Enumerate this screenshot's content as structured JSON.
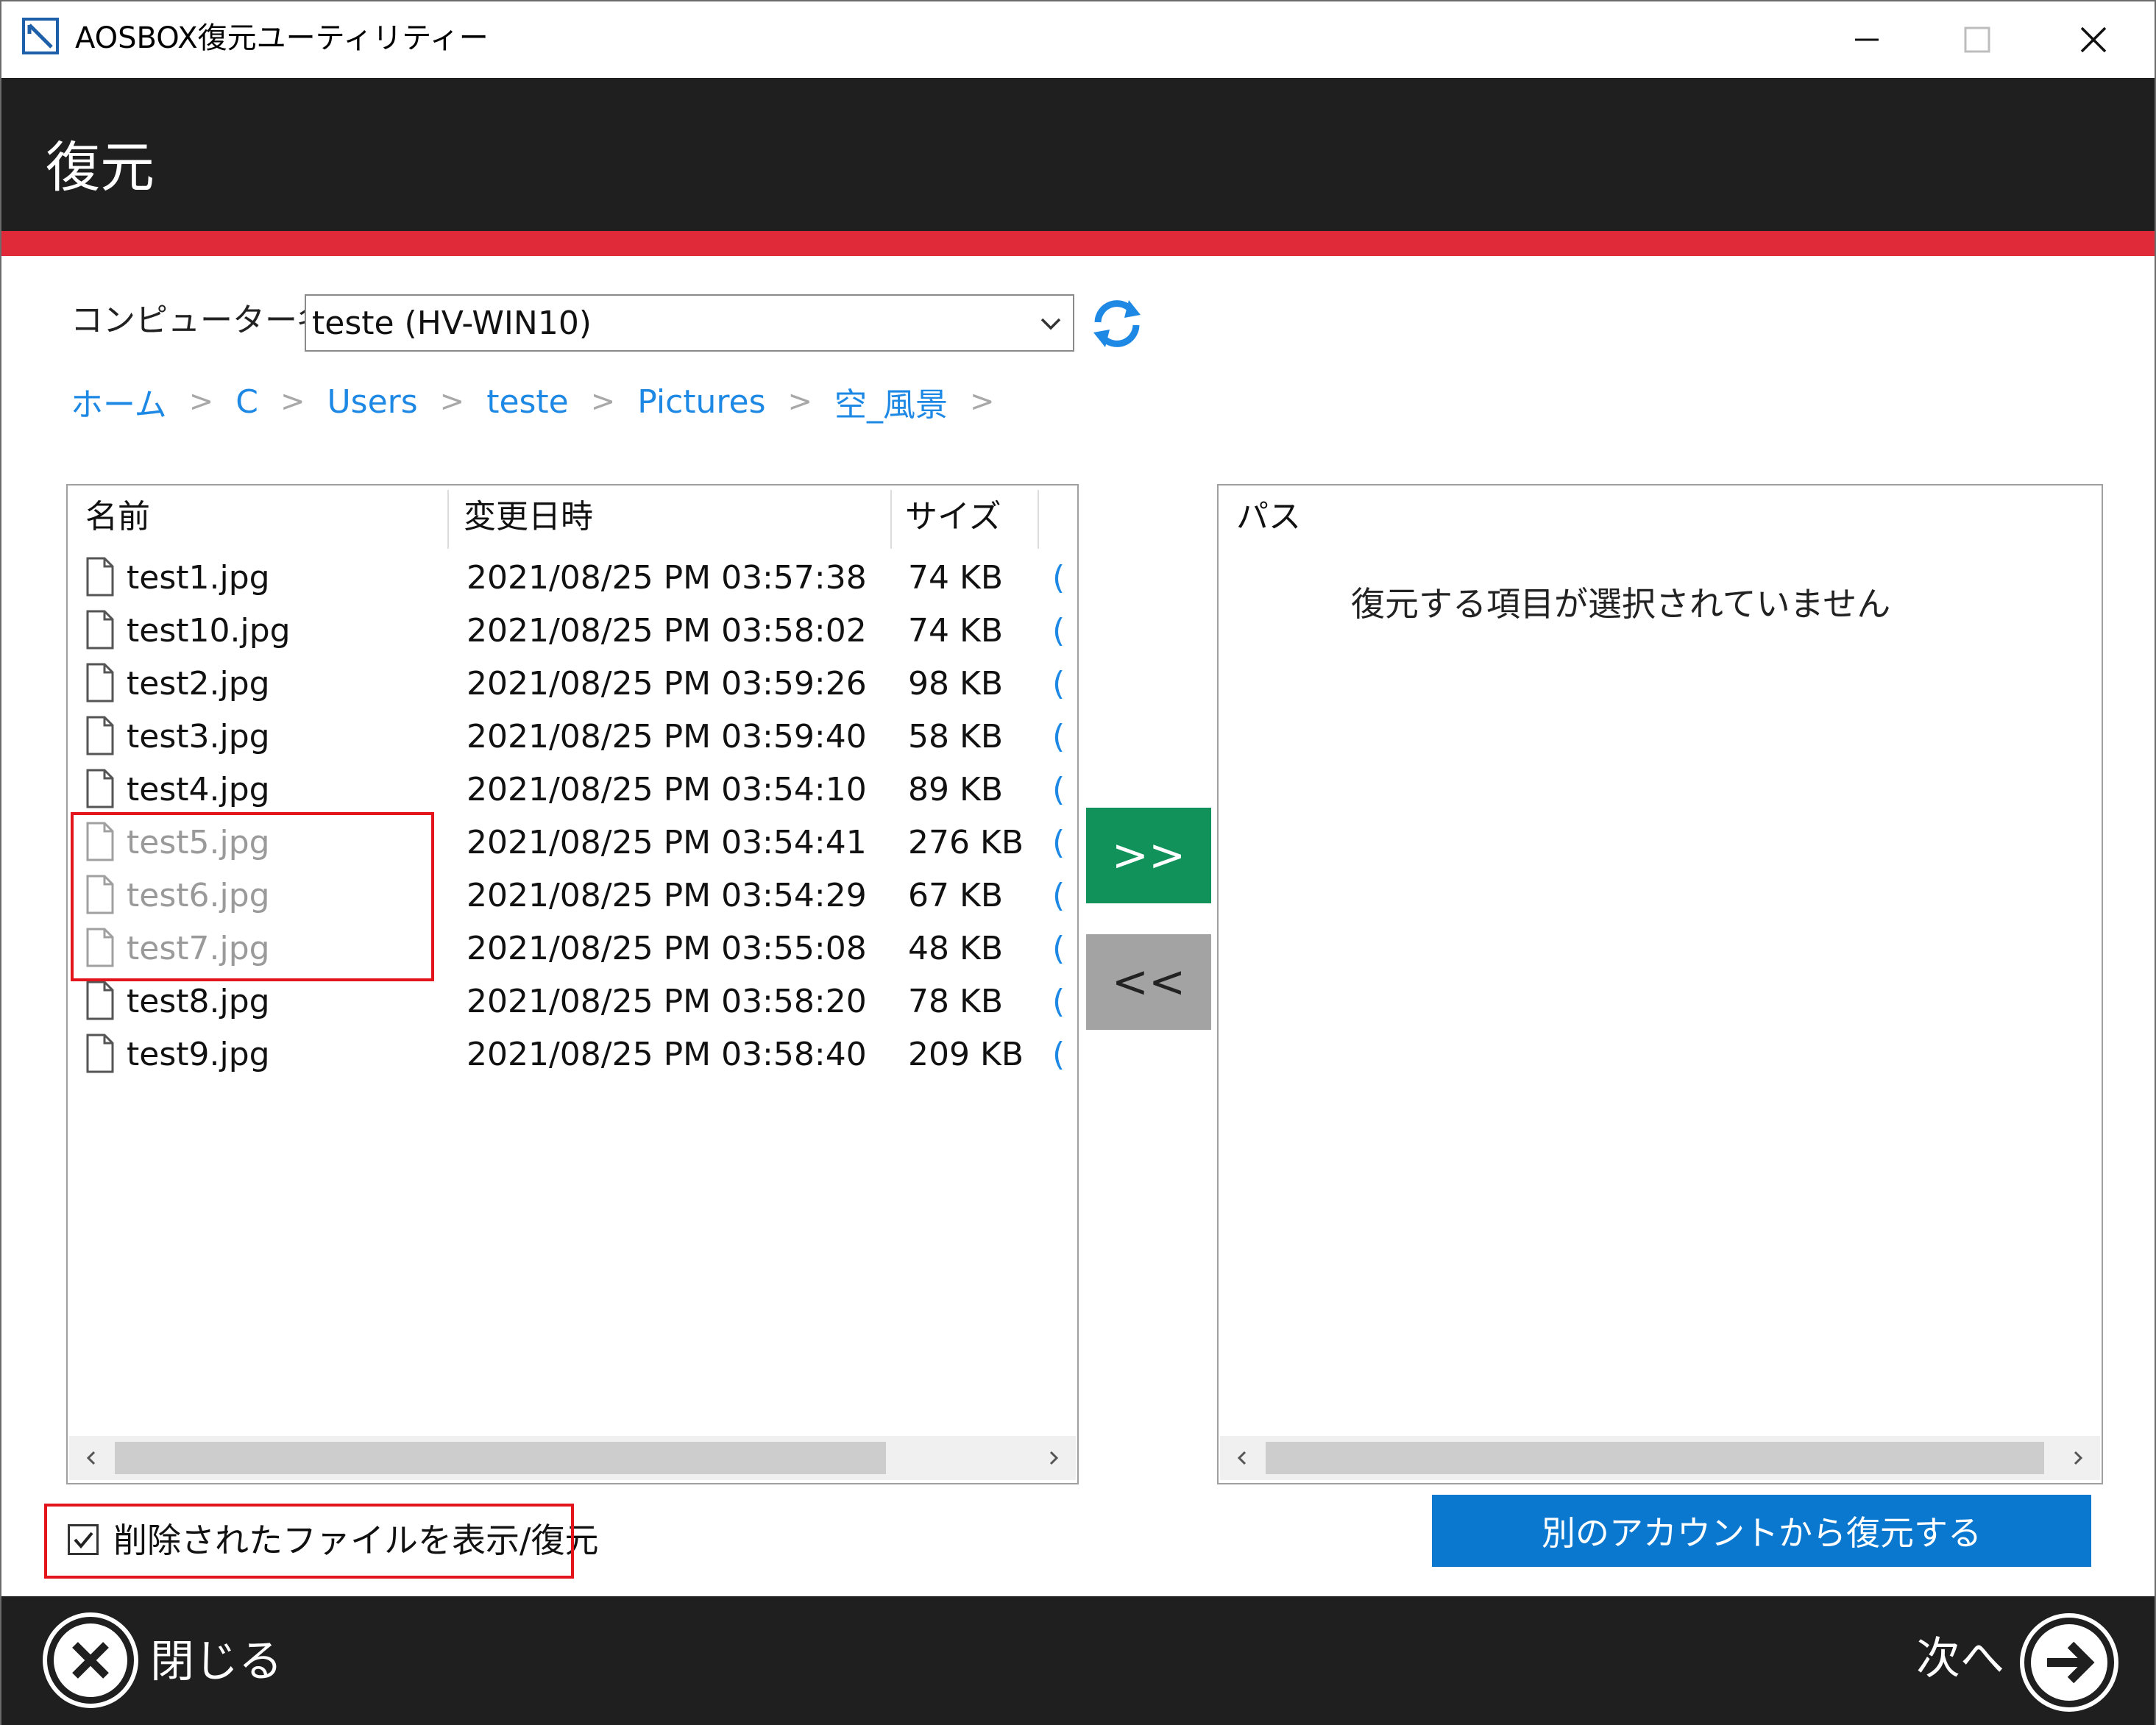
{
  "window": {
    "title": "AOSBOX復元ユーティリティー",
    "controls": {
      "minimize": "minimize-icon",
      "maximize": "maximize-icon",
      "close": "close-icon"
    }
  },
  "header": {
    "title": "復元",
    "accent_color": "#e02a3a",
    "background_color": "#1f1f1f"
  },
  "computer": {
    "label": "コンピューター名:",
    "selected": "teste (HV-WIN10)"
  },
  "breadcrumb": {
    "items": [
      "ホーム",
      "C",
      "Users",
      "teste",
      "Pictures",
      "空_風景"
    ],
    "separator": ">"
  },
  "file_list": {
    "columns": {
      "name": "名前",
      "modified": "変更日時",
      "size": "サイズ"
    },
    "rows": [
      {
        "name": "test1.jpg",
        "modified": "2021/08/25 PM 03:57:38",
        "size": "74 KB",
        "extra": "(",
        "deleted": false
      },
      {
        "name": "test10.jpg",
        "modified": "2021/08/25 PM 03:58:02",
        "size": "74 KB",
        "extra": "(",
        "deleted": false
      },
      {
        "name": "test2.jpg",
        "modified": "2021/08/25 PM 03:59:26",
        "size": "98 KB",
        "extra": "(",
        "deleted": false
      },
      {
        "name": "test3.jpg",
        "modified": "2021/08/25 PM 03:59:40",
        "size": "58 KB",
        "extra": "(",
        "deleted": false
      },
      {
        "name": "test4.jpg",
        "modified": "2021/08/25 PM 03:54:10",
        "size": "89 KB",
        "extra": "(",
        "deleted": false
      },
      {
        "name": "test5.jpg",
        "modified": "2021/08/25 PM 03:54:41",
        "size": "276 KB",
        "extra": "(",
        "deleted": true
      },
      {
        "name": "test6.jpg",
        "modified": "2021/08/25 PM 03:54:29",
        "size": "67 KB",
        "extra": "(",
        "deleted": true
      },
      {
        "name": "test7.jpg",
        "modified": "2021/08/25 PM 03:55:08",
        "size": "48 KB",
        "extra": "(",
        "deleted": true
      },
      {
        "name": "test8.jpg",
        "modified": "2021/08/25 PM 03:58:20",
        "size": "78 KB",
        "extra": "(",
        "deleted": false
      },
      {
        "name": "test9.jpg",
        "modified": "2021/08/25 PM 03:58:40",
        "size": "209 KB",
        "extra": "(",
        "deleted": false
      }
    ]
  },
  "transfer": {
    "add_label": ">>",
    "remove_label": "<<",
    "add_color": "#12925b",
    "remove_color": "#a3a3a3"
  },
  "selection_panel": {
    "header": "パス",
    "empty_message": "復元する項目が選択されていません"
  },
  "options": {
    "show_deleted_label": "削除されたファイルを表示/復元",
    "show_deleted_checked": true
  },
  "other_account_button": {
    "label": "別のアカウントから復元する",
    "color": "#0b78d0"
  },
  "footer": {
    "close_label": "閉じる",
    "next_label": "次へ"
  }
}
